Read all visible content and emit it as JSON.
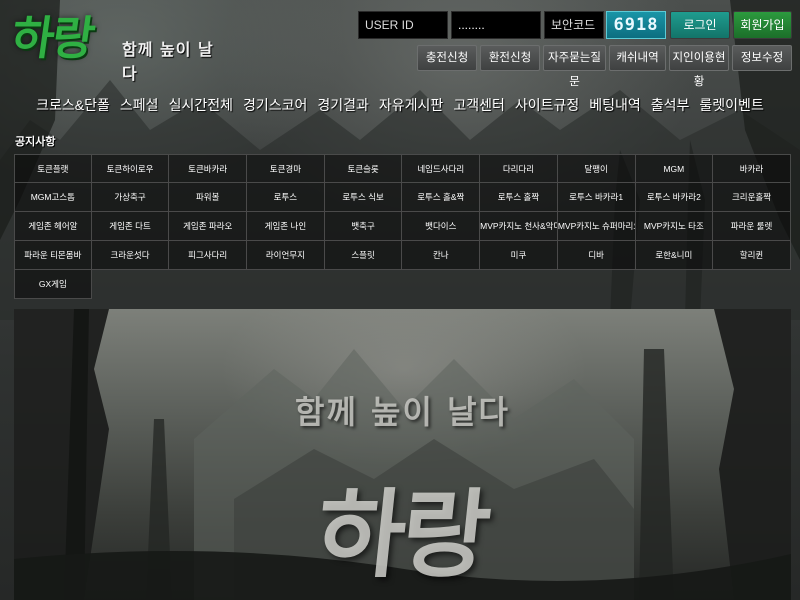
{
  "logo": {
    "main": "하랑",
    "sub": "함께 높이 날다"
  },
  "login": {
    "user_id_placeholder": "USER ID",
    "password_value": "........",
    "security_placeholder": "보안코드",
    "captcha": "6918",
    "login_label": "로그인",
    "signup_label": "회원가입"
  },
  "sub_buttons": [
    "충전신청",
    "환전신청",
    "자주묻는질문",
    "캐쉬내역",
    "지인이용현황",
    "정보수정"
  ],
  "nav": [
    "크로스&단폴",
    "스페셜",
    "실시간전체",
    "경기스코어",
    "경기결과",
    "자유게시판",
    "고객센터",
    "사이트규정",
    "베팅내역",
    "출석부",
    "룰렛이벤트"
  ],
  "notice_title": "공지사항",
  "games": [
    "토큰플랫",
    "토큰하이로우",
    "토큰바카라",
    "토큰경마",
    "토큰슬롯",
    "네임드사다리",
    "다리다리",
    "달팽이",
    "MGM",
    "바카라",
    "MGM고스톱",
    "가상축구",
    "파워볼",
    "로투스",
    "로투스 식보",
    "로투스 홀&짝",
    "로투스 홀짝",
    "로투스 바카라1",
    "로투스 바카라2",
    "크리운홀짝",
    "게임존 헤어알",
    "게임존 다트",
    "게임존 파라오",
    "게임존 나인",
    "뱃축구",
    "뱃다이스",
    "MVP카지노 천사&악마",
    "MVP카지노 슈퍼마리오",
    "MVP카지노 타조",
    "파라운 룰렛",
    "파라운 티몬몸바",
    "크라운섯다",
    "피그사다리",
    "라이언무지",
    "스플릿",
    "칸나",
    "미쿠",
    "디바",
    "로한&니미",
    "할리퀸",
    "GX게임"
  ],
  "banner": {
    "sub": "함께 높이 날다",
    "main": "하랑"
  },
  "colors": {
    "logo_green": "#2fb043",
    "teal_button": "#1f9c8f",
    "green_button": "#2c9a3e",
    "captcha_bg": "#1a95a7"
  }
}
